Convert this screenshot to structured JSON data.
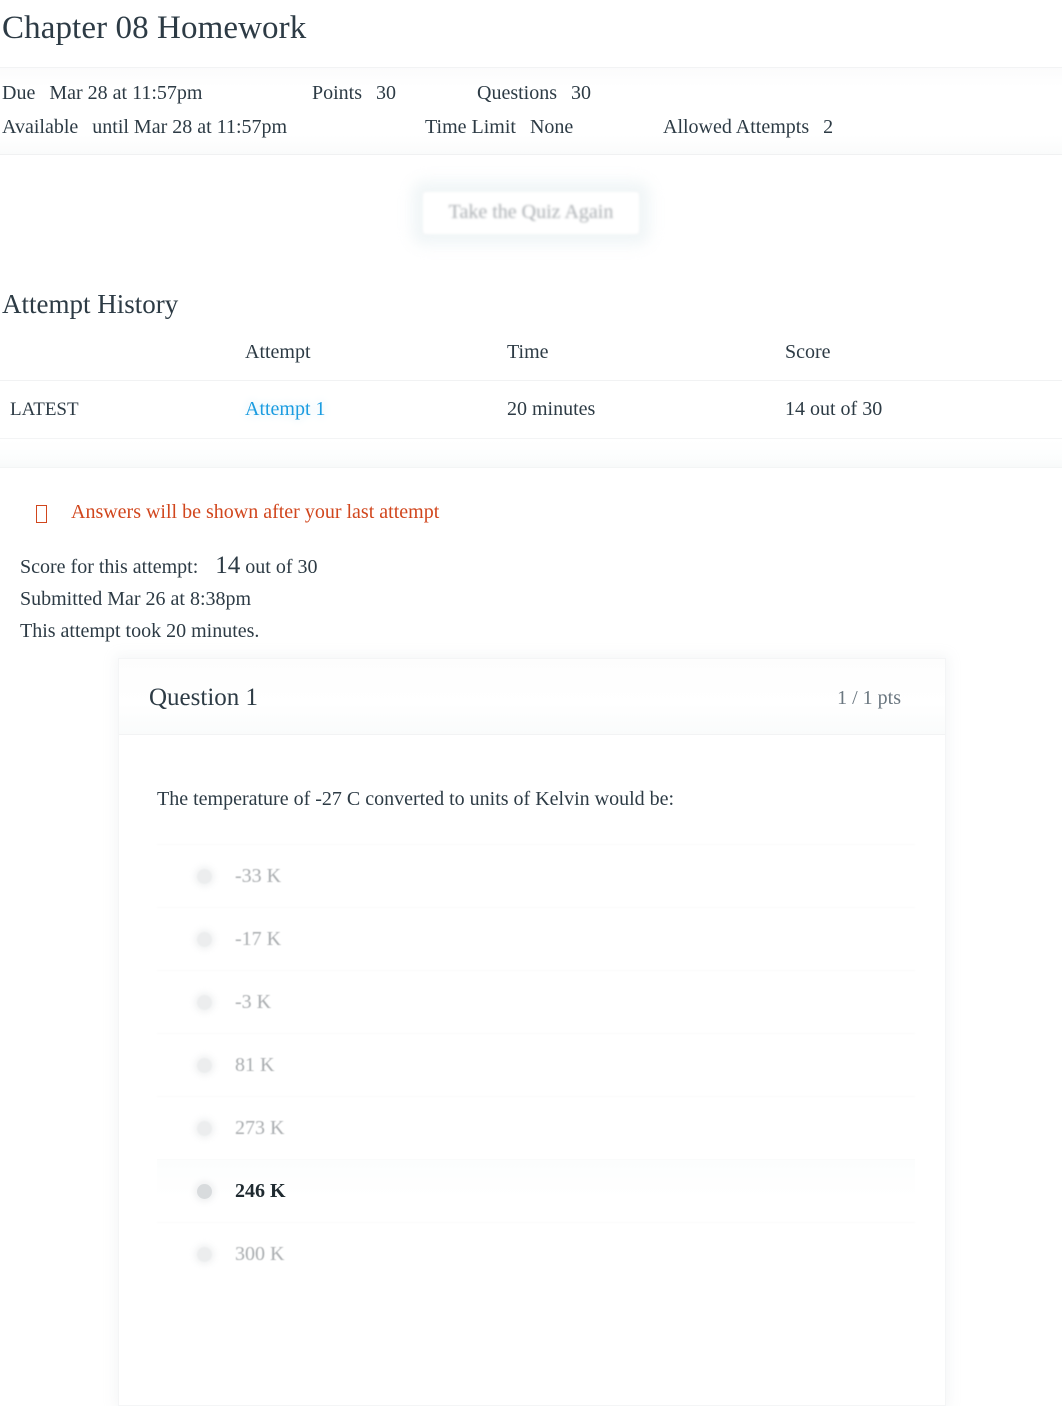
{
  "page": {
    "title": "Chapter 08 Homework"
  },
  "quiz_details": {
    "row1": [
      {
        "label": "Due",
        "value": "Mar 28 at 11:57pm"
      },
      {
        "label": "Points",
        "value": "30"
      },
      {
        "label": "Questions",
        "value": "30"
      }
    ],
    "row2": [
      {
        "label": "Available",
        "value": "until Mar 28 at 11:57pm"
      },
      {
        "label": "Time Limit",
        "value": "None"
      },
      {
        "label": "Allowed Attempts",
        "value": "2"
      }
    ]
  },
  "actions": {
    "take_quiz_again": "Take the Quiz Again"
  },
  "attempt_history": {
    "heading": "Attempt History",
    "columns": [
      "",
      "Attempt",
      "Time",
      "Score"
    ],
    "rows": [
      {
        "flag": "LATEST",
        "attempt": "Attempt 1",
        "time": "20 minutes",
        "score": "14 out of 30"
      }
    ]
  },
  "notice": {
    "icon": "warning-icon",
    "text": "Answers will be shown after your last attempt"
  },
  "attempt_summary": {
    "score_label": "Score for this attempt:",
    "score_value": "14",
    "score_suffix": "out of 30",
    "submitted": "Submitted Mar 26 at 8:38pm",
    "duration": "This attempt took 20 minutes."
  },
  "question": {
    "name": "Question 1",
    "points": "1 / 1 pts",
    "text": "The temperature of -27 C converted to units of Kelvin would be:",
    "answers": [
      {
        "label": "-33 K",
        "selected": false
      },
      {
        "label": "-17 K",
        "selected": false
      },
      {
        "label": "-3 K",
        "selected": false
      },
      {
        "label": "81 K",
        "selected": false
      },
      {
        "label": "273 K",
        "selected": false
      },
      {
        "label": "246 K",
        "selected": true
      },
      {
        "label": "300 K",
        "selected": false
      }
    ]
  },
  "colors": {
    "link": "#1b9ce0",
    "notice": "#d1461d",
    "text": "#2d3b45",
    "muted": "#6b7780"
  }
}
